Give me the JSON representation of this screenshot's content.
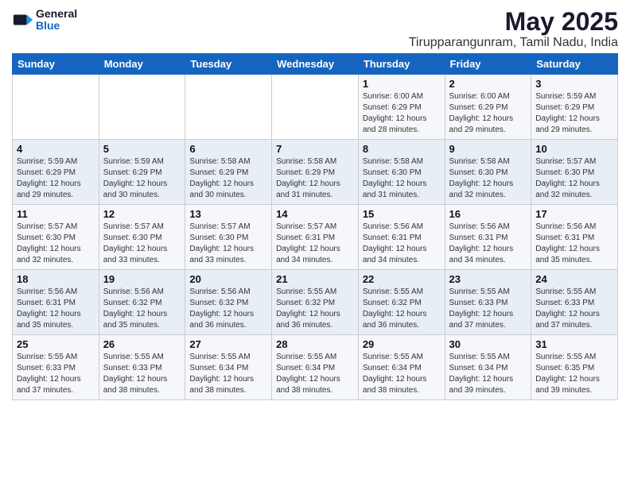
{
  "logo": {
    "general": "General",
    "blue": "Blue"
  },
  "title": "May 2025",
  "location": "Tirupparangunram, Tamil Nadu, India",
  "days_of_week": [
    "Sunday",
    "Monday",
    "Tuesday",
    "Wednesday",
    "Thursday",
    "Friday",
    "Saturday"
  ],
  "weeks": [
    [
      {
        "day": "",
        "info": ""
      },
      {
        "day": "",
        "info": ""
      },
      {
        "day": "",
        "info": ""
      },
      {
        "day": "",
        "info": ""
      },
      {
        "day": "1",
        "info": "Sunrise: 6:00 AM\nSunset: 6:29 PM\nDaylight: 12 hours\nand 28 minutes."
      },
      {
        "day": "2",
        "info": "Sunrise: 6:00 AM\nSunset: 6:29 PM\nDaylight: 12 hours\nand 29 minutes."
      },
      {
        "day": "3",
        "info": "Sunrise: 5:59 AM\nSunset: 6:29 PM\nDaylight: 12 hours\nand 29 minutes."
      }
    ],
    [
      {
        "day": "4",
        "info": "Sunrise: 5:59 AM\nSunset: 6:29 PM\nDaylight: 12 hours\nand 29 minutes."
      },
      {
        "day": "5",
        "info": "Sunrise: 5:59 AM\nSunset: 6:29 PM\nDaylight: 12 hours\nand 30 minutes."
      },
      {
        "day": "6",
        "info": "Sunrise: 5:58 AM\nSunset: 6:29 PM\nDaylight: 12 hours\nand 30 minutes."
      },
      {
        "day": "7",
        "info": "Sunrise: 5:58 AM\nSunset: 6:29 PM\nDaylight: 12 hours\nand 31 minutes."
      },
      {
        "day": "8",
        "info": "Sunrise: 5:58 AM\nSunset: 6:30 PM\nDaylight: 12 hours\nand 31 minutes."
      },
      {
        "day": "9",
        "info": "Sunrise: 5:58 AM\nSunset: 6:30 PM\nDaylight: 12 hours\nand 32 minutes."
      },
      {
        "day": "10",
        "info": "Sunrise: 5:57 AM\nSunset: 6:30 PM\nDaylight: 12 hours\nand 32 minutes."
      }
    ],
    [
      {
        "day": "11",
        "info": "Sunrise: 5:57 AM\nSunset: 6:30 PM\nDaylight: 12 hours\nand 32 minutes."
      },
      {
        "day": "12",
        "info": "Sunrise: 5:57 AM\nSunset: 6:30 PM\nDaylight: 12 hours\nand 33 minutes."
      },
      {
        "day": "13",
        "info": "Sunrise: 5:57 AM\nSunset: 6:30 PM\nDaylight: 12 hours\nand 33 minutes."
      },
      {
        "day": "14",
        "info": "Sunrise: 5:57 AM\nSunset: 6:31 PM\nDaylight: 12 hours\nand 34 minutes."
      },
      {
        "day": "15",
        "info": "Sunrise: 5:56 AM\nSunset: 6:31 PM\nDaylight: 12 hours\nand 34 minutes."
      },
      {
        "day": "16",
        "info": "Sunrise: 5:56 AM\nSunset: 6:31 PM\nDaylight: 12 hours\nand 34 minutes."
      },
      {
        "day": "17",
        "info": "Sunrise: 5:56 AM\nSunset: 6:31 PM\nDaylight: 12 hours\nand 35 minutes."
      }
    ],
    [
      {
        "day": "18",
        "info": "Sunrise: 5:56 AM\nSunset: 6:31 PM\nDaylight: 12 hours\nand 35 minutes."
      },
      {
        "day": "19",
        "info": "Sunrise: 5:56 AM\nSunset: 6:32 PM\nDaylight: 12 hours\nand 35 minutes."
      },
      {
        "day": "20",
        "info": "Sunrise: 5:56 AM\nSunset: 6:32 PM\nDaylight: 12 hours\nand 36 minutes."
      },
      {
        "day": "21",
        "info": "Sunrise: 5:55 AM\nSunset: 6:32 PM\nDaylight: 12 hours\nand 36 minutes."
      },
      {
        "day": "22",
        "info": "Sunrise: 5:55 AM\nSunset: 6:32 PM\nDaylight: 12 hours\nand 36 minutes."
      },
      {
        "day": "23",
        "info": "Sunrise: 5:55 AM\nSunset: 6:33 PM\nDaylight: 12 hours\nand 37 minutes."
      },
      {
        "day": "24",
        "info": "Sunrise: 5:55 AM\nSunset: 6:33 PM\nDaylight: 12 hours\nand 37 minutes."
      }
    ],
    [
      {
        "day": "25",
        "info": "Sunrise: 5:55 AM\nSunset: 6:33 PM\nDaylight: 12 hours\nand 37 minutes."
      },
      {
        "day": "26",
        "info": "Sunrise: 5:55 AM\nSunset: 6:33 PM\nDaylight: 12 hours\nand 38 minutes."
      },
      {
        "day": "27",
        "info": "Sunrise: 5:55 AM\nSunset: 6:34 PM\nDaylight: 12 hours\nand 38 minutes."
      },
      {
        "day": "28",
        "info": "Sunrise: 5:55 AM\nSunset: 6:34 PM\nDaylight: 12 hours\nand 38 minutes."
      },
      {
        "day": "29",
        "info": "Sunrise: 5:55 AM\nSunset: 6:34 PM\nDaylight: 12 hours\nand 38 minutes."
      },
      {
        "day": "30",
        "info": "Sunrise: 5:55 AM\nSunset: 6:34 PM\nDaylight: 12 hours\nand 39 minutes."
      },
      {
        "day": "31",
        "info": "Sunrise: 5:55 AM\nSunset: 6:35 PM\nDaylight: 12 hours\nand 39 minutes."
      }
    ]
  ]
}
